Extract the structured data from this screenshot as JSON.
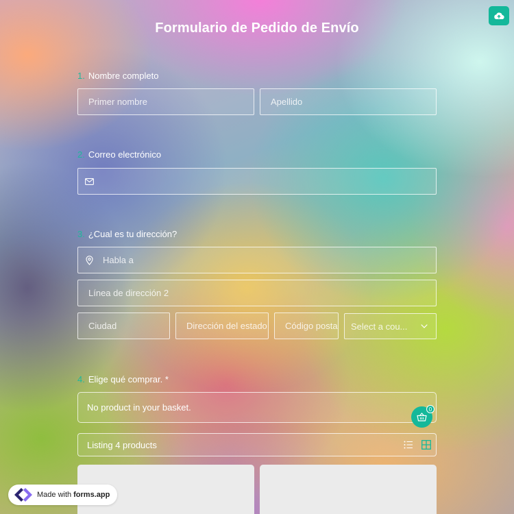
{
  "title": "Formulario de Pedido de Envío",
  "upload_icon": "cloud-upload-icon",
  "questions": [
    {
      "number": "1.",
      "label": "Nombre completo",
      "fields": {
        "first_name": "Primer nombre",
        "last_name": "Apellido"
      }
    },
    {
      "number": "2.",
      "label": "Correo electrónico",
      "fields": {
        "email_icon": "envelope-icon",
        "email": ""
      }
    },
    {
      "number": "3.",
      "label": "¿Cual es tu dirección?",
      "fields": {
        "address_icon": "map-pin-icon",
        "address_line_1": "Habla a",
        "address_line_2": "Línea de dirección 2",
        "city": "Ciudad",
        "state": "Dirección del estado",
        "postal_code": "Código postal",
        "country": "Select a country"
      }
    },
    {
      "number": "4.",
      "label": "Elige qué comprar.",
      "required": "*",
      "basket_text": "No product in your basket.",
      "basket_count": "0",
      "listing_text": "Listing 4 products"
    }
  ],
  "country_display": "Select a cou...",
  "badge": {
    "prefix": "Made with",
    "brand": "forms.app"
  },
  "colors": {
    "accent": "#14b89a",
    "text": "#ffffff"
  }
}
